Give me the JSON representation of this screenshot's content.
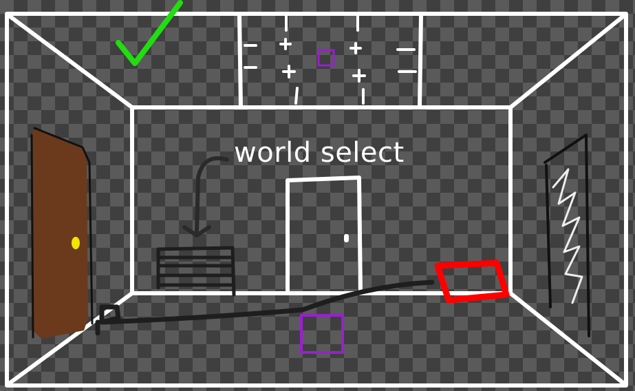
{
  "room": {
    "title": "world select",
    "colors": {
      "outline": "#ffffff",
      "door_brown": "#6b3a1c",
      "knob_yellow": "#f2e600",
      "check_green": "#22dd11",
      "marker_purple": "#9a1fd0",
      "mat_red": "#ff0000",
      "scribble_black": "#1e1e1e"
    },
    "icons": {
      "checkmark": "check-icon",
      "arrow": "down-arrow-icon"
    }
  }
}
